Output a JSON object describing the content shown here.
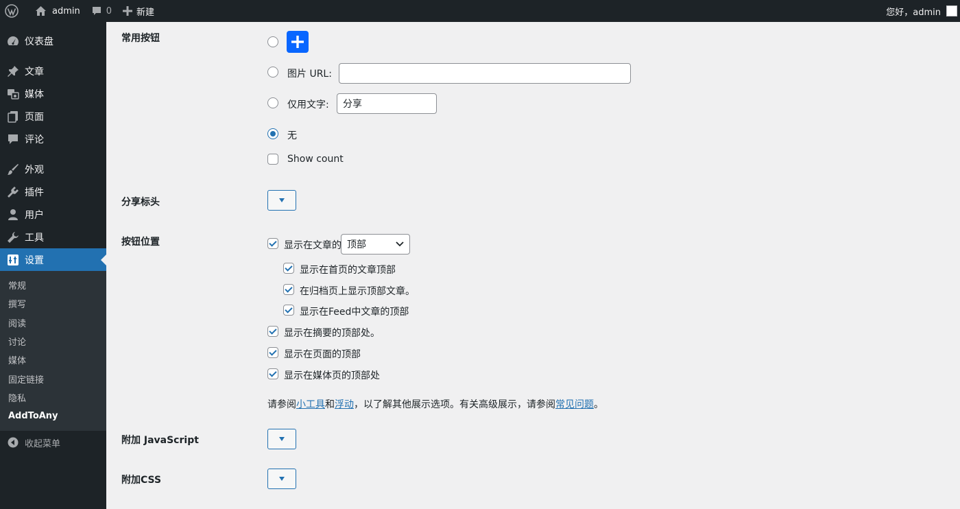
{
  "adminbar": {
    "site_name": "admin",
    "comments_count": "0",
    "new_label": "新建",
    "greeting": "您好，admin"
  },
  "sidebar": {
    "items": [
      {
        "label": "仪表盘",
        "icon": "dashboard-icon"
      },
      {
        "label": "文章",
        "icon": "pin-icon"
      },
      {
        "label": "媒体",
        "icon": "media-icon"
      },
      {
        "label": "页面",
        "icon": "page-icon"
      },
      {
        "label": "评论",
        "icon": "comment-icon"
      },
      {
        "label": "外观",
        "icon": "brush-icon"
      },
      {
        "label": "插件",
        "icon": "plugin-icon"
      },
      {
        "label": "用户",
        "icon": "user-icon"
      },
      {
        "label": "工具",
        "icon": "wrench-icon"
      },
      {
        "label": "设置",
        "icon": "settings-icon"
      }
    ],
    "submenu": [
      "常规",
      "撰写",
      "阅读",
      "讨论",
      "媒体",
      "固定链接",
      "隐私",
      "AddToAny"
    ],
    "collapse_label": "收起菜单",
    "accent_color": "#2271b1"
  },
  "settings": {
    "universal_button": {
      "label": "常用按钮",
      "image_url_label": "图片 URL:",
      "image_url_value": "",
      "text_only_label": "仅用文字:",
      "text_only_value": "分享",
      "none_label": "无",
      "show_count_label": "Show count",
      "selected": "none",
      "show_count": false,
      "button_color": "#0866ff"
    },
    "share_header": {
      "label": "分享标头"
    },
    "button_placement": {
      "label": "按钮位置",
      "posts_label": "显示在文章的",
      "posts_position": "顶部",
      "home_label": "显示在首页的文章顶部",
      "archive_label": "在归档页上显示顶部文章。",
      "feed_label": "显示在Feed中文章的顶部",
      "excerpt_label": "显示在摘要的顶部处。",
      "pages_label": "显示在页面的顶部",
      "media_label": "显示在媒体页的顶部处",
      "note_parts": {
        "p1": "请参阅",
        "link1": "小工具",
        "p2": "和",
        "link2": "浮动",
        "p3": "，以了解其他展示选项。有关高级展示，请参阅",
        "link3": "常见问题",
        "p4": "。"
      }
    },
    "additional_js": {
      "label": "附加 JavaScript"
    },
    "additional_css": {
      "label": "附加CSS"
    }
  }
}
